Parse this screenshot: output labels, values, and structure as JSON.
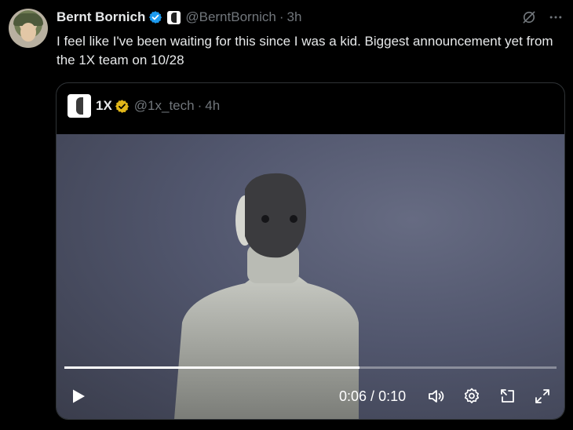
{
  "tweet": {
    "author_name": "Bernt Bornich",
    "handle": "@BerntBornich",
    "separator": "·",
    "time": "3h",
    "text": "I feel like I've been waiting for this since I was a kid. Biggest announcement yet from the 1X team on 10/28"
  },
  "quoted": {
    "author_name": "1X",
    "handle": "@1x_tech",
    "separator": "·",
    "time": "4h"
  },
  "video": {
    "current_time": "0:06",
    "duration": "0:10",
    "time_separator": " / ",
    "progress_fraction": 0.6
  },
  "colors": {
    "background": "#000000",
    "text_primary": "#e7e9ea",
    "text_secondary": "#71767b",
    "verified_blue": "#1d9bf0",
    "verified_gold": "#e2b719",
    "border": "#2f3336"
  },
  "icons": {
    "verified": "verified-badge-icon",
    "gold_verified": "gold-verified-badge-icon",
    "grok": "grok-icon",
    "more": "more-dots-icon",
    "play": "play-icon",
    "volume": "volume-icon",
    "settings": "settings-gear-icon",
    "pip": "picture-in-picture-icon",
    "fullscreen": "fullscreen-icon"
  }
}
